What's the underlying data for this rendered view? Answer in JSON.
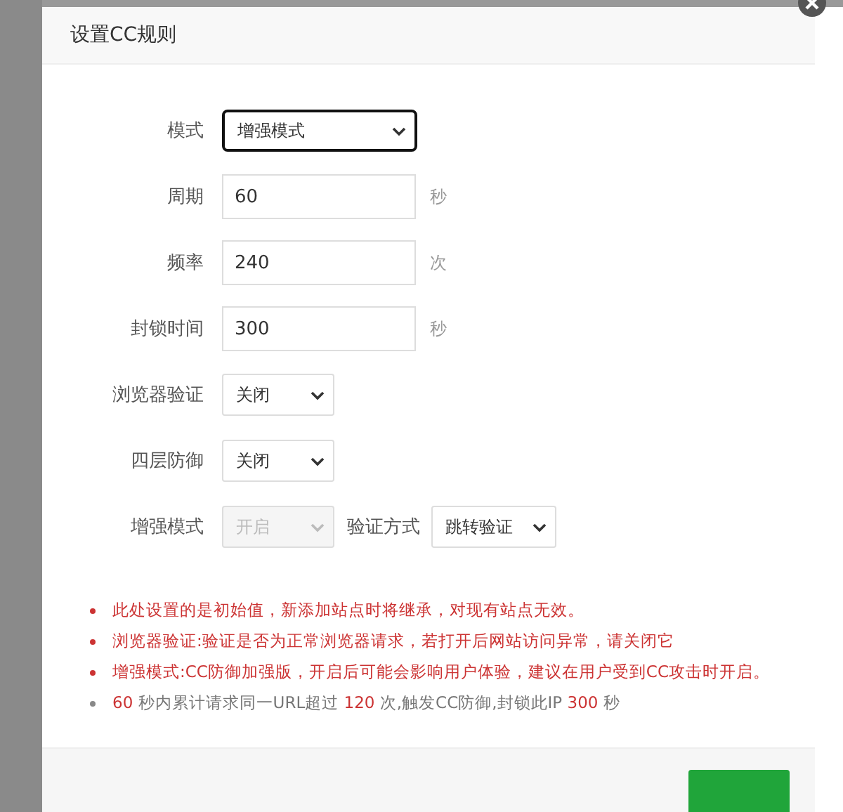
{
  "dialog": {
    "title": "设置CC规则"
  },
  "form": [
    {
      "kind": "select",
      "label": "模式",
      "value": "增强模式",
      "focused": true,
      "disabled": false
    },
    {
      "kind": "input",
      "label": "周期",
      "value": "60",
      "unit": "秒"
    },
    {
      "kind": "input",
      "label": "频率",
      "value": "240",
      "unit": "次"
    },
    {
      "kind": "input",
      "label": "封锁时间",
      "value": "300",
      "unit": "秒"
    },
    {
      "kind": "select",
      "label": "浏览器验证",
      "value": "关闭",
      "focused": false,
      "disabled": false
    },
    {
      "kind": "select",
      "label": "四层防御",
      "value": "关闭",
      "focused": false,
      "disabled": false
    },
    {
      "kind": "pair",
      "label": "增强模式",
      "value": "开启",
      "disabled": true,
      "second_label": "验证方式",
      "second_value": "跳转验证"
    }
  ],
  "notes": [
    {
      "kind": "warning",
      "text": "此处设置的是初始值，新添加站点时将继承，对现有站点无效。"
    },
    {
      "kind": "warning",
      "text": "浏览器验证:验证是否为正常浏览器请求，若打开后网站访问异常，请关闭它"
    },
    {
      "kind": "warning",
      "text": "增强模式:CC防御加强版，开启后可能会影响用户体验，建议在用户受到CC攻击时开启。"
    },
    {
      "kind": "summary",
      "parts": [
        {
          "text": "60",
          "highlight": true
        },
        {
          "text": " 秒内累计请求同一URL超过 ",
          "highlight": false
        },
        {
          "text": "120",
          "highlight": true
        },
        {
          "text": " 次,触发CC防御,封锁此IP ",
          "highlight": false
        },
        {
          "text": "300",
          "highlight": true
        },
        {
          "text": " 秒",
          "highlight": false
        }
      ]
    }
  ]
}
